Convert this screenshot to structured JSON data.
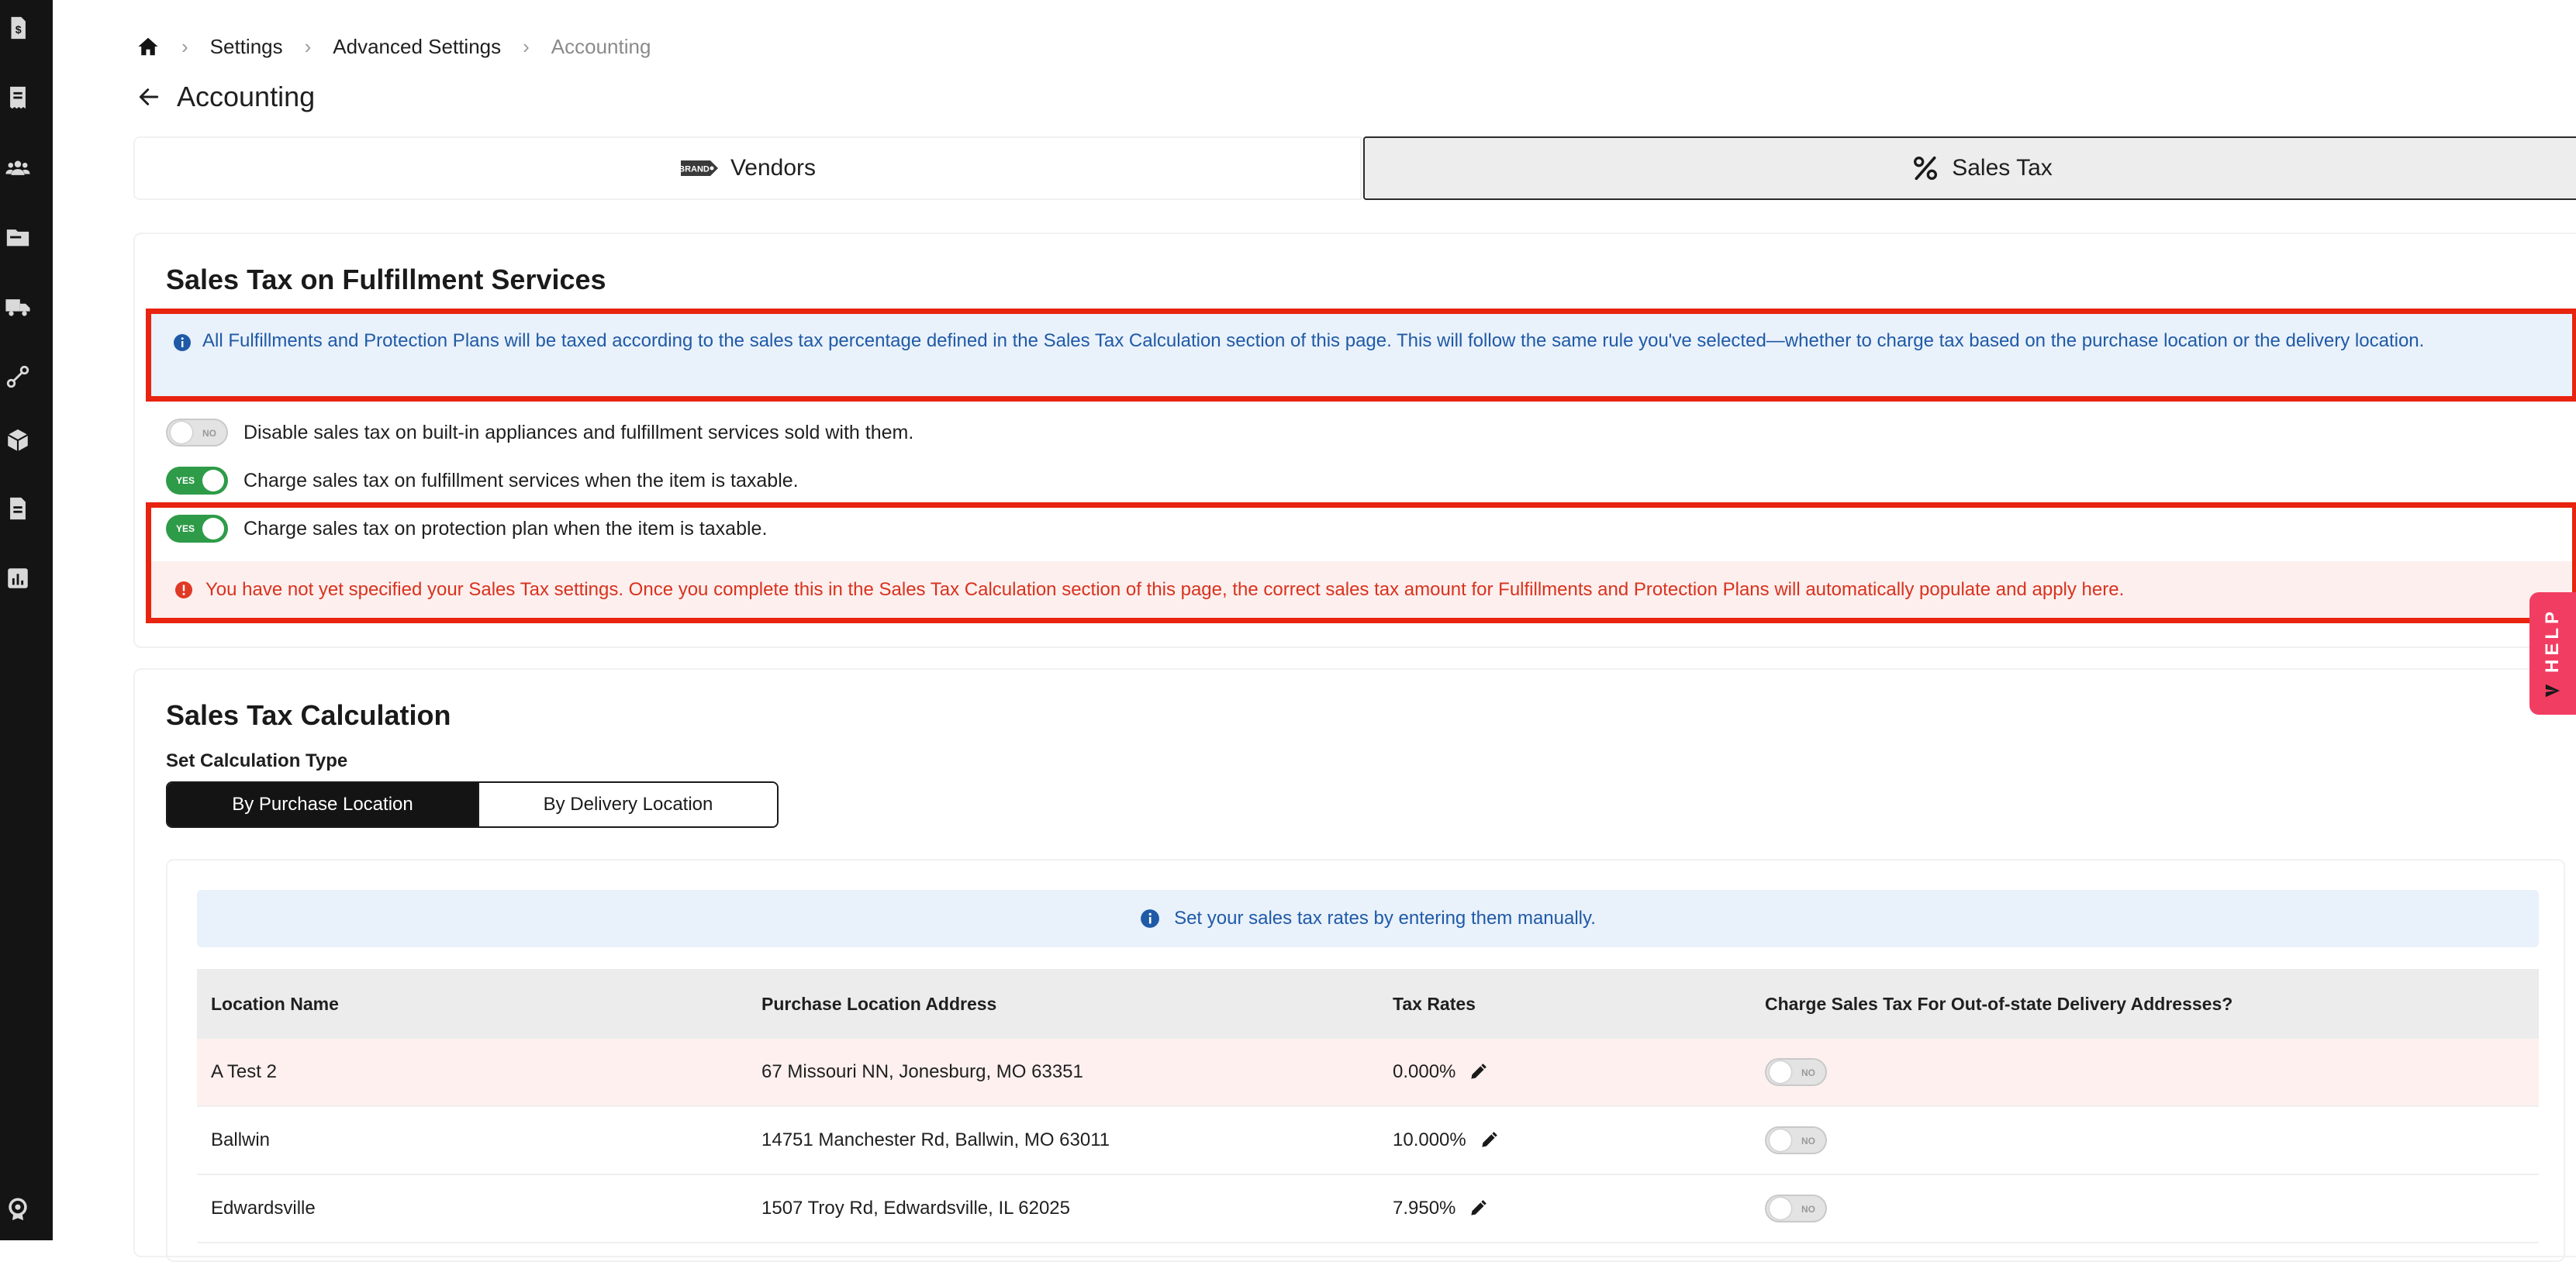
{
  "sidebar": {
    "icons": [
      "dollar-document-icon",
      "receipt-icon",
      "users-icon",
      "folder-icon",
      "truck-icon",
      "route-icon",
      "box-icon",
      "document-icon",
      "chart-icon",
      "badge-icon"
    ]
  },
  "breadcrumb": {
    "items": [
      "Settings",
      "Advanced Settings"
    ],
    "current": "Accounting"
  },
  "page": {
    "title": "Accounting"
  },
  "tabs": [
    {
      "label": "Vendors",
      "icon": "brand-tag-icon",
      "badge": "BRAND"
    },
    {
      "label": "Sales Tax",
      "icon": "percent-icon",
      "active": true
    }
  ],
  "fulfillment": {
    "title": "Sales Tax on Fulfillment Services",
    "info": "All Fulfillments and Protection Plans will be taxed according to the sales tax percentage defined in the Sales Tax Calculation section of this page. This will follow the same rule you've selected—whether to charge tax based on the purchase location or the delivery location.",
    "toggles": [
      {
        "state": "NO",
        "label": "Disable sales tax on built-in appliances and fulfillment services sold with them."
      },
      {
        "state": "YES",
        "label": "Charge sales tax on fulfillment services when the item is taxable."
      },
      {
        "state": "YES",
        "label": "Charge sales tax on protection plan when the item is taxable."
      }
    ],
    "warning": "You have not yet specified your Sales Tax settings. Once you complete this in the Sales Tax Calculation section of this page, the correct sales tax amount for Fulfillments and Protection Plans will automatically populate and apply here."
  },
  "calculation": {
    "title": "Sales Tax Calculation",
    "type_label": "Set Calculation Type",
    "options": [
      "By Purchase Location",
      "By Delivery Location"
    ],
    "selected": "By Purchase Location",
    "info": "Set your sales tax rates by entering them manually.",
    "table": {
      "headers": [
        "Location Name",
        "Purchase Location Address",
        "Tax Rates",
        "Charge Sales Tax For Out-of-state Delivery Addresses?"
      ],
      "rows": [
        {
          "name": "A Test 2",
          "address": "67 Missouri NN, Jonesburg, MO 63351",
          "rate": "0.000%",
          "out_of_state": "NO"
        },
        {
          "name": "Ballwin",
          "address": "14751 Manchester Rd, Ballwin, MO 63011",
          "rate": "10.000%",
          "out_of_state": "NO"
        },
        {
          "name": "Edwardsville",
          "address": "1507 Troy Rd, Edwardsville, IL 62025",
          "rate": "7.950%",
          "out_of_state": "NO"
        }
      ]
    }
  },
  "help": {
    "label": "HELP"
  },
  "colors": {
    "sidebar": "#141414",
    "toggle_on": "#2e9b48",
    "info_text": "#1f5aa6",
    "error_text": "#d8321f",
    "highlight_box": "#e8230f",
    "help_tab": "#f23d63"
  }
}
